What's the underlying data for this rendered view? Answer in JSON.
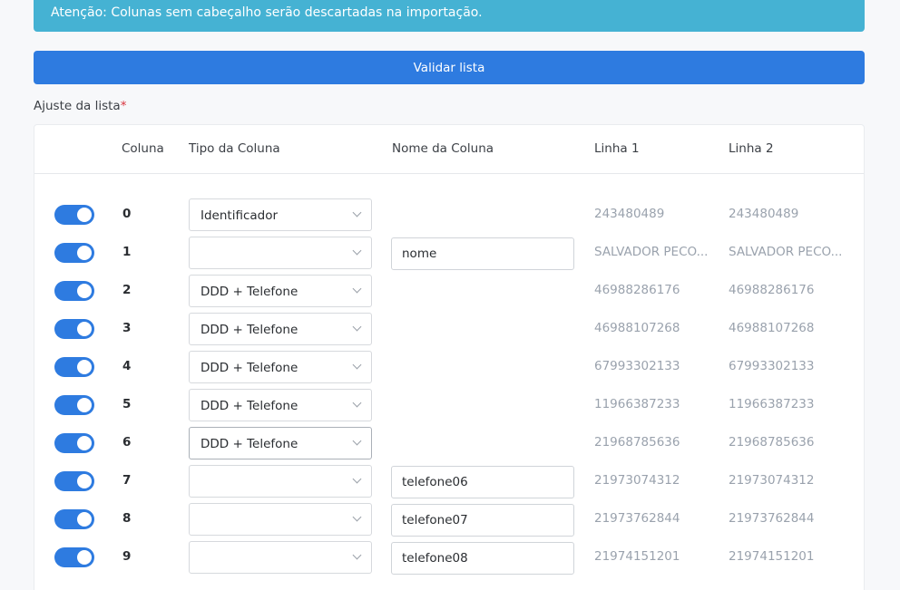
{
  "alert": {
    "text": "Atenção: Colunas sem cabeçalho serão descartadas na importação."
  },
  "validate_button": {
    "label": "Validar lista"
  },
  "section": {
    "label": "Ajuste da lista",
    "required_mark": "*"
  },
  "table": {
    "headers": {
      "coluna": "Coluna",
      "tipo": "Tipo da Coluna",
      "nome": "Nome da Coluna",
      "linha1": "Linha 1",
      "linha2": "Linha 2"
    },
    "rows": [
      {
        "enabled": true,
        "index": "0",
        "type": "Identificador",
        "name": null,
        "line1": "243480489",
        "line2": "243480489"
      },
      {
        "enabled": true,
        "index": "1",
        "type": "",
        "name": "nome",
        "line1": "SALVADOR PECO...",
        "line2": "SALVADOR PECO..."
      },
      {
        "enabled": true,
        "index": "2",
        "type": "DDD + Telefone",
        "name": null,
        "line1": "46988286176",
        "line2": "46988286176"
      },
      {
        "enabled": true,
        "index": "3",
        "type": "DDD + Telefone",
        "name": null,
        "line1": "46988107268",
        "line2": "46988107268"
      },
      {
        "enabled": true,
        "index": "4",
        "type": "DDD + Telefone",
        "name": null,
        "line1": "67993302133",
        "line2": "67993302133"
      },
      {
        "enabled": true,
        "index": "5",
        "type": "DDD + Telefone",
        "name": null,
        "line1": "11966387233",
        "line2": "11966387233"
      },
      {
        "enabled": true,
        "index": "6",
        "type": "DDD + Telefone",
        "name": null,
        "line1": "21968785636",
        "line2": "21968785636"
      },
      {
        "enabled": true,
        "index": "7",
        "type": "",
        "name": "telefone06",
        "line1": "21973074312",
        "line2": "21973074312"
      },
      {
        "enabled": true,
        "index": "8",
        "type": "",
        "name": "telefone07",
        "line1": "21973762844",
        "line2": "21973762844"
      },
      {
        "enabled": true,
        "index": "9",
        "type": "",
        "name": "telefone08",
        "line1": "21974151201",
        "line2": "21974151201"
      }
    ]
  },
  "colors": {
    "primary": "#2e7be0",
    "alert": "#45b2d3",
    "muted_text": "#9aa2ad"
  }
}
